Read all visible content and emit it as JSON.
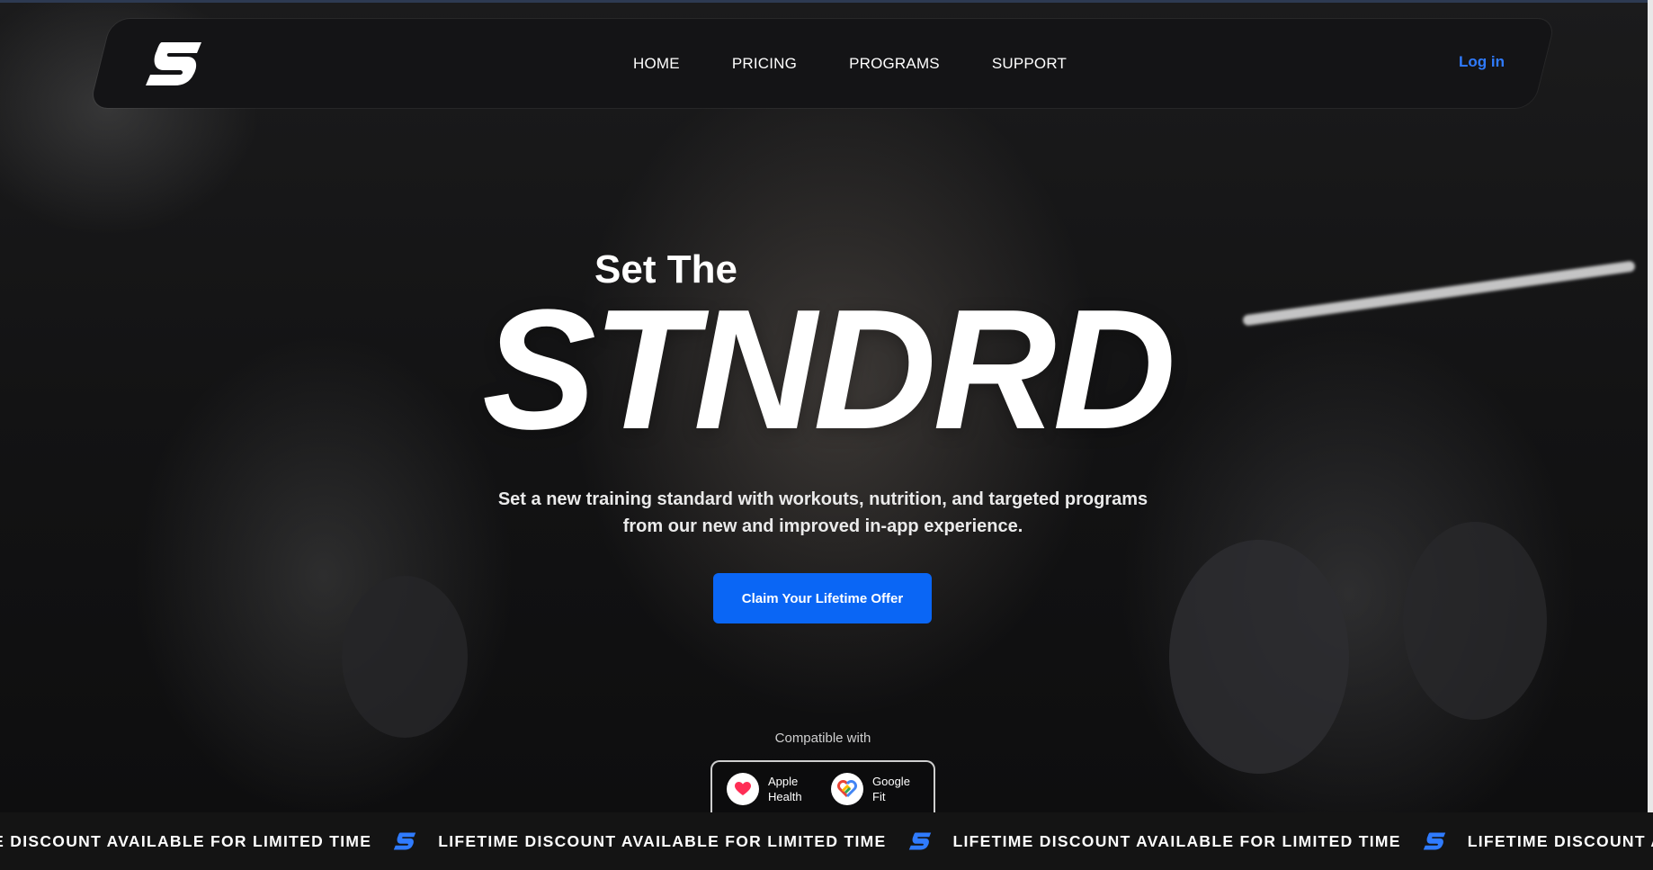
{
  "brand": {
    "accent": "#0a66f5",
    "login_color": "#2f7bff",
    "logo_icon": "stndrd-s-logo-icon"
  },
  "nav": {
    "items": [
      {
        "label": "HOME"
      },
      {
        "label": "PRICING"
      },
      {
        "label": "PROGRAMS"
      },
      {
        "label": "SUPPORT"
      }
    ],
    "login_label": "Log in"
  },
  "hero": {
    "kicker": "Set The",
    "headline": "STNDRD",
    "subtitle_line1": "Set a new training standard with workouts, nutrition, and targeted programs",
    "subtitle_line2": "from our new and improved in-app experience.",
    "cta_label": "Claim Your Lifetime Offer"
  },
  "compatibility": {
    "label": "Compatible with",
    "items": [
      {
        "name_line1": "Apple",
        "name_line2": "Health",
        "icon": "apple-health-icon"
      },
      {
        "name_line1": "Google",
        "name_line2": "Fit",
        "icon": "google-fit-icon"
      }
    ]
  },
  "ticker": {
    "message": "LIFETIME DISCOUNT AVAILABLE FOR LIMITED TIME",
    "icon": "stndrd-s-logo-icon"
  }
}
